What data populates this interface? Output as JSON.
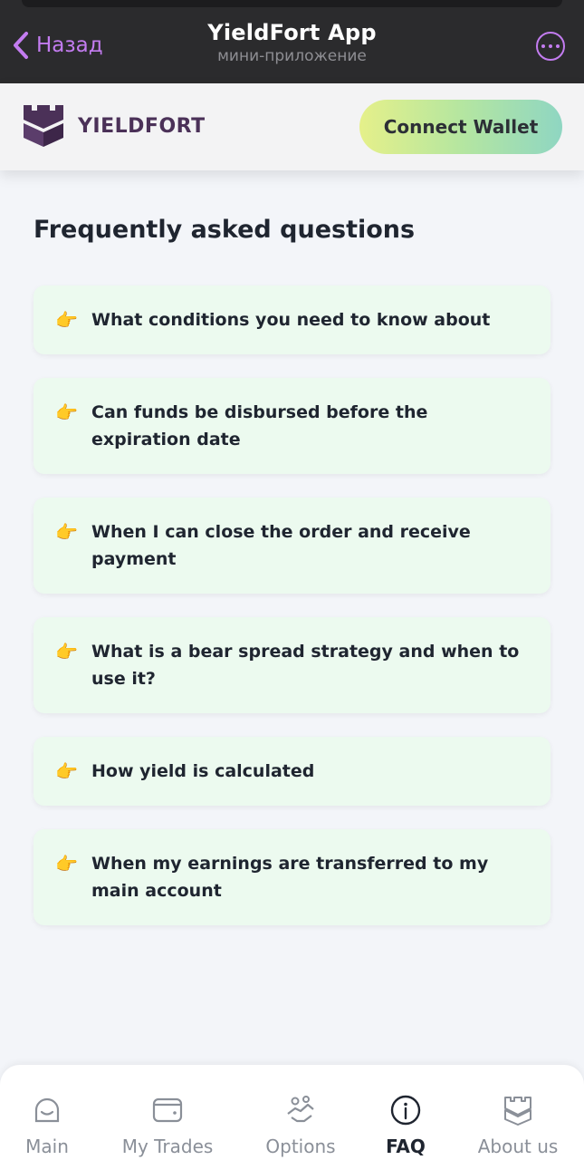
{
  "telegram": {
    "back_label": "Назад",
    "title": "YieldFort App",
    "subtitle": "мини-приложение"
  },
  "header": {
    "logo_text": "YIELDFORT",
    "connect_label": "Connect Wallet"
  },
  "main": {
    "title": "Frequently asked questions",
    "faq": [
      {
        "icon": "👉",
        "question": "What conditions you need to know about"
      },
      {
        "icon": "👉",
        "question": "Can funds be disbursed before the expiration date"
      },
      {
        "icon": "👉",
        "question": "When I can close the order and receive payment"
      },
      {
        "icon": "👉",
        "question": "What is a bear spread strategy and when to use it?"
      },
      {
        "icon": "👉",
        "question": "How yield is calculated"
      },
      {
        "icon": "👉",
        "question": "When my earnings are transferred to my main account"
      }
    ]
  },
  "nav": {
    "items": [
      {
        "label": "Main",
        "icon": "smile-icon"
      },
      {
        "label": "My Trades",
        "icon": "wallet-icon"
      },
      {
        "label": "Options",
        "icon": "handshake-icon"
      },
      {
        "label": "FAQ",
        "icon": "info-icon",
        "active": true
      },
      {
        "label": "About us",
        "icon": "castle-icon"
      }
    ]
  },
  "colors": {
    "accent_purple": "#c37cf0",
    "brand_dark": "#4b3158",
    "card_bg": "#ecfaef"
  }
}
